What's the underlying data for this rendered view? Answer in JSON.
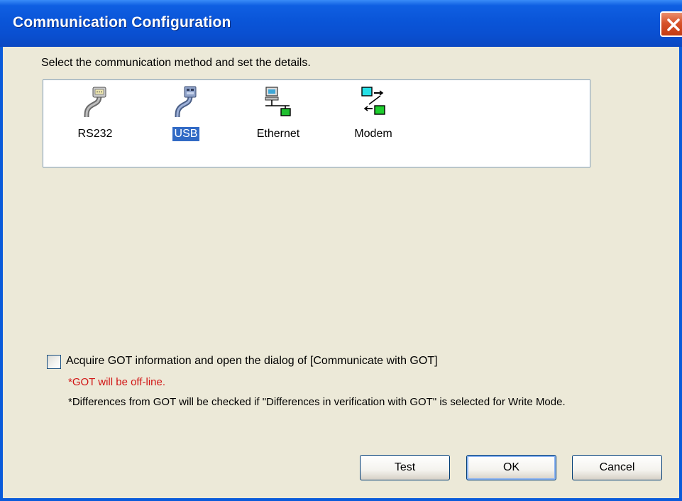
{
  "window": {
    "title": "Communication Configuration",
    "close_icon": "close-icon"
  },
  "instruction": "Select the communication method and set the details.",
  "methods": [
    {
      "label": "RS232",
      "icon": "serial-cable-icon",
      "selected": false
    },
    {
      "label": "USB",
      "icon": "usb-cable-icon",
      "selected": true
    },
    {
      "label": "Ethernet",
      "icon": "ethernet-network-icon",
      "selected": false
    },
    {
      "label": "Modem",
      "icon": "modem-icon",
      "selected": false
    }
  ],
  "acquire_option": {
    "label": "Acquire GOT information and open the dialog of [Communicate with GOT]",
    "checked": false,
    "note_offline": "*GOT will be off-line.",
    "note_differences": "*Differences from GOT will be checked if \"Differences in verification with GOT\" is selected for Write Mode."
  },
  "buttons": {
    "test": "Test",
    "ok": "OK",
    "cancel": "Cancel"
  },
  "colors": {
    "titlebar": "#0A55D8",
    "dialog_bg": "#ECE9D8",
    "selection": "#316AC5",
    "warning_text": "#D11313"
  }
}
